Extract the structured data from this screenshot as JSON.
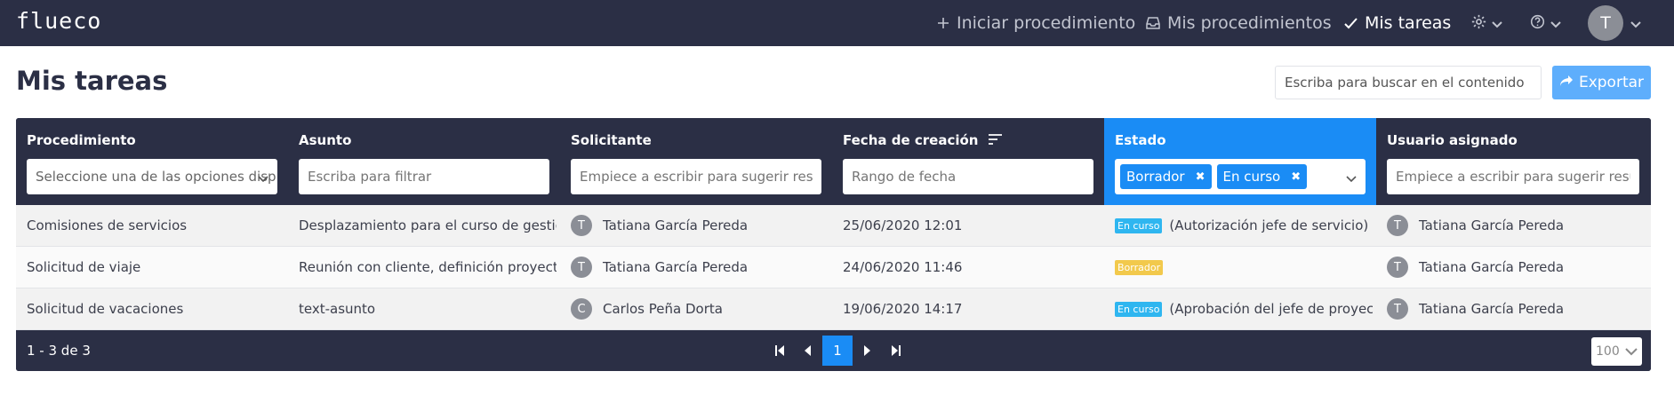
{
  "app": {
    "logo_text": "flueco"
  },
  "nav": {
    "items": [
      {
        "label": "Iniciar procedimiento",
        "icon": "plus-icon"
      },
      {
        "label": "Mis procedimientos",
        "icon": "inbox-icon"
      },
      {
        "label": "Mis tareas",
        "icon": "check-icon"
      }
    ],
    "settings_icon": "gear-icon",
    "help_icon": "question-icon",
    "user_initial": "T"
  },
  "page": {
    "title": "Mis tareas",
    "search_placeholder": "Escriba para buscar en el contenido",
    "export_label": "Exportar"
  },
  "table": {
    "columns": [
      {
        "label": "Procedimiento",
        "filter_placeholder": "Seleccione una de las opciones disp"
      },
      {
        "label": "Asunto",
        "filter_placeholder": "Escriba para filtrar"
      },
      {
        "label": "Solicitante",
        "filter_placeholder": "Empiece a escribir para sugerir resultado"
      },
      {
        "label": "Fecha de creación",
        "filter_placeholder": "Rango de fecha"
      },
      {
        "label": "Estado",
        "selected_tags": [
          "Borrador",
          "En curso"
        ]
      },
      {
        "label": "Usuario asignado",
        "filter_placeholder": "Empiece a escribir para sugerir resultado"
      }
    ],
    "rows": [
      {
        "procedimiento": "Comisiones de servicios",
        "asunto": "Desplazamiento para el curso de gestión ...",
        "solicitante_initial": "T",
        "solicitante": "Tatiana García Pereda",
        "fecha": "25/06/2020 12:01",
        "estado_badge": "En curso",
        "estado_detail": "(Autorización jefe de servicio)",
        "usuario_initial": "T",
        "usuario": "Tatiana García Pereda"
      },
      {
        "procedimiento": "Solicitud de viaje",
        "asunto": "Reunión con cliente, definición proyecto ...",
        "solicitante_initial": "T",
        "solicitante": "Tatiana García Pereda",
        "fecha": "24/06/2020 11:46",
        "estado_badge": "Borrador",
        "estado_detail": "",
        "usuario_initial": "T",
        "usuario": "Tatiana García Pereda"
      },
      {
        "procedimiento": "Solicitud de vacaciones",
        "asunto": "text-asunto",
        "solicitante_initial": "C",
        "solicitante": "Carlos Peña Dorta",
        "fecha": "19/06/2020 14:17",
        "estado_badge": "En curso",
        "estado_detail": "(Aprobación del jefe de proyectos)",
        "usuario_initial": "T",
        "usuario": "Tatiana García Pereda"
      }
    ],
    "footer": {
      "count": "1 - 3 de 3",
      "current_page": "1",
      "per_page": "100"
    }
  },
  "colors": {
    "navbar": "#2b2f45",
    "accent": "#1a8cf5",
    "export": "#5eaefc",
    "badge_en_curso": "#2fb6f0",
    "badge_borrador": "#f2c94c"
  }
}
